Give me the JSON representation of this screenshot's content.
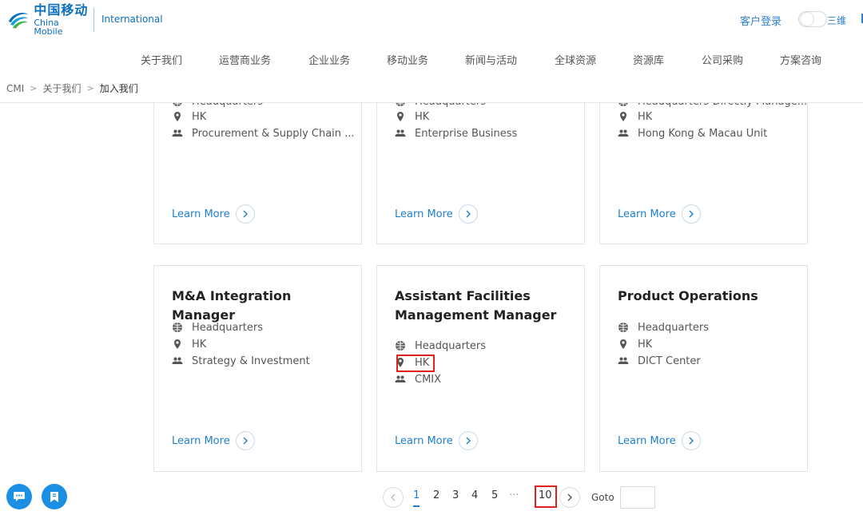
{
  "header": {
    "logo_cn": "中国移动",
    "logo_en": "China Mobile",
    "international": "International",
    "login": "客户登录",
    "mode_3d": "三维",
    "brand_color": "#0a6fbf"
  },
  "nav": {
    "items": [
      "关于我们",
      "运营商业务",
      "企业业务",
      "移动业务",
      "新闻与活动",
      "全球资源",
      "资源库",
      "公司采购",
      "方案咨询"
    ]
  },
  "breadcrumb": {
    "items": [
      "CMI",
      "关于我们",
      "加入我们"
    ]
  },
  "jobs_top": [
    {
      "level": "Headquarters",
      "location": "HK",
      "department": "Procurement & Supply Chain ..."
    },
    {
      "level": "Headquarters",
      "location": "HK",
      "department": "Enterprise Business"
    },
    {
      "level": "Headquarters-Directly Manage...",
      "location": "HK",
      "department": "Hong Kong & Macau Unit"
    }
  ],
  "jobs": [
    {
      "title": "M&A Integration Manager",
      "level": "Headquarters",
      "location": "HK",
      "department": "Strategy & Investment"
    },
    {
      "title": "Assistant Facilities Management Manager",
      "level": "Headquarters",
      "location": "HK",
      "department": "CMIX"
    },
    {
      "title": "Product Operations",
      "level": "Headquarters",
      "location": "HK",
      "department": "DICT Center"
    }
  ],
  "learn_more": "Learn More",
  "pagination": {
    "pages": [
      "1",
      "2",
      "3",
      "4",
      "5"
    ],
    "ellipsis": "···",
    "last": "10",
    "current": "1",
    "goto_label": "Goto",
    "goto_value": ""
  },
  "colors": {
    "accent": "#1e7fd1",
    "highlight": "#e02020",
    "float_button": "#1a8fe3"
  }
}
